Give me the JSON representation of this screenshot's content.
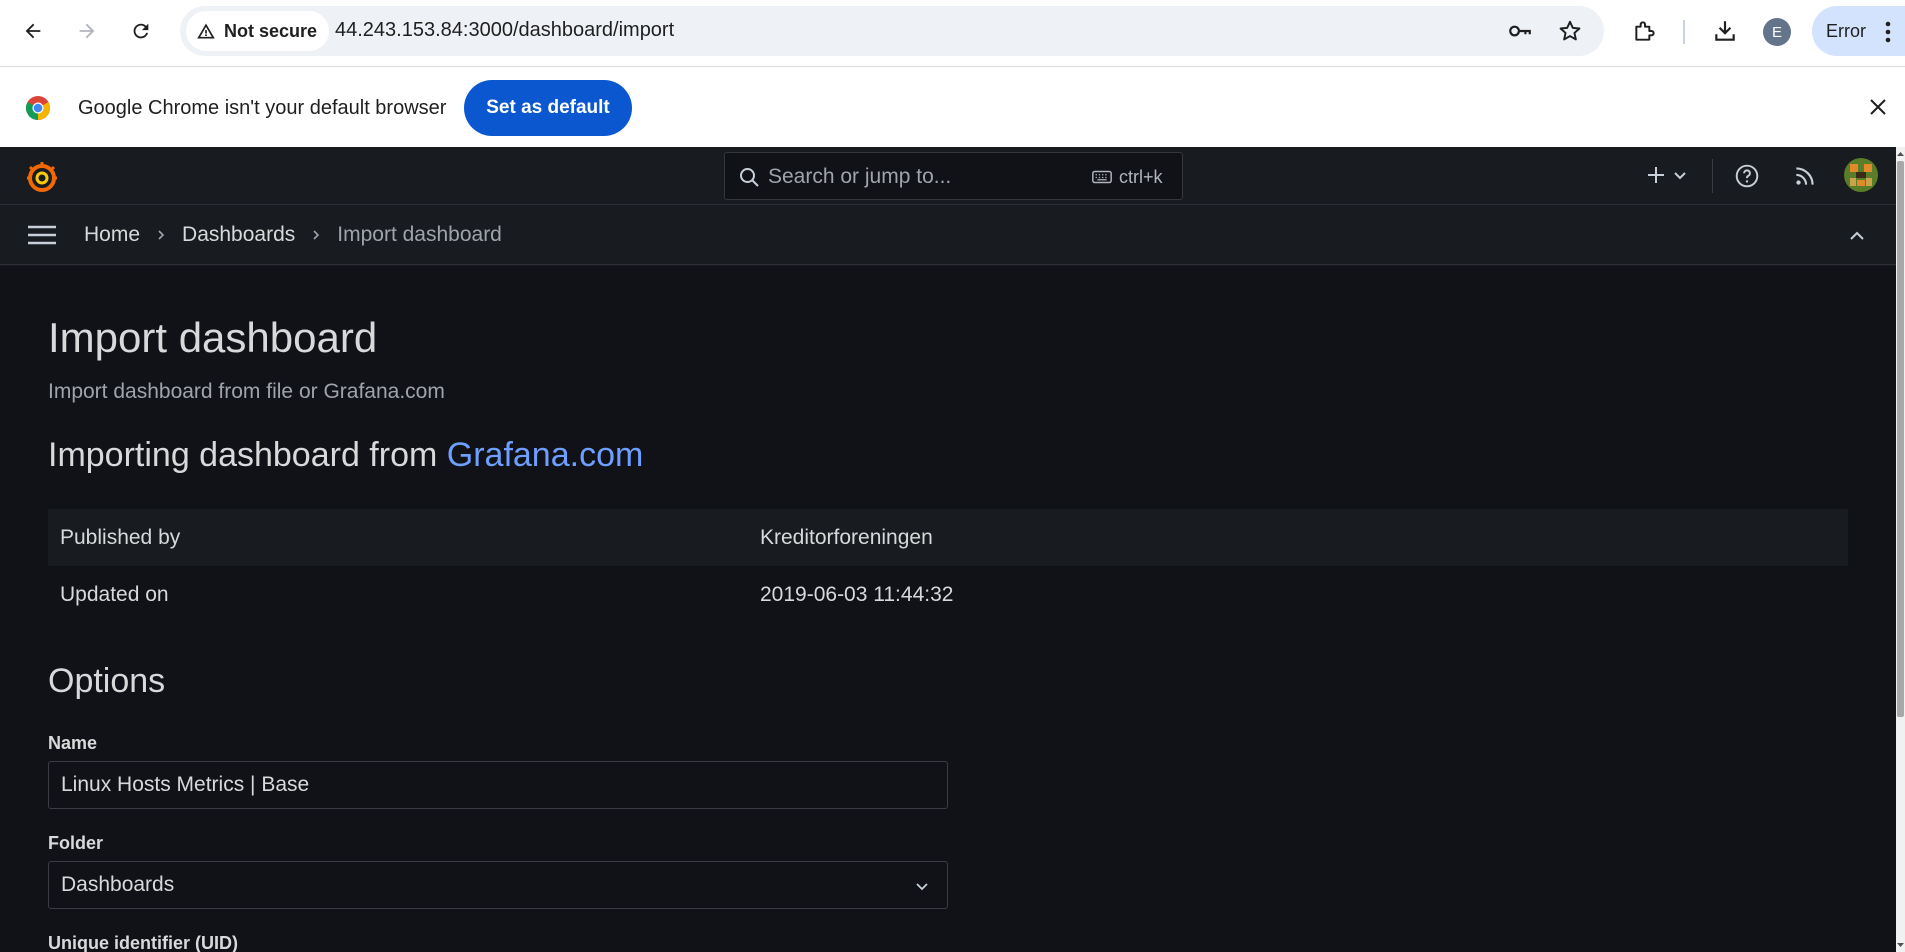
{
  "browser": {
    "security_label": "Not secure",
    "url": "44.243.153.84:3000/dashboard/import",
    "profile_initial": "E",
    "error_label": "Error"
  },
  "infobar": {
    "message": "Google Chrome isn't your default browser",
    "button_label": "Set as default"
  },
  "topnav": {
    "search_placeholder": "Search or jump to...",
    "shortcut": "ctrl+k"
  },
  "breadcrumb": [
    {
      "label": "Home"
    },
    {
      "label": "Dashboards"
    },
    {
      "label": "Import dashboard"
    }
  ],
  "page": {
    "title": "Import dashboard",
    "subtitle": "Import dashboard from file or Grafana.com",
    "import_heading_prefix": "Importing dashboard from ",
    "import_heading_link": "Grafana.com"
  },
  "info_rows": [
    {
      "key": "Published by",
      "value": "Kreditorforeningen"
    },
    {
      "key": "Updated on",
      "value": "2019-06-03 11:44:32"
    }
  ],
  "options": {
    "heading": "Options",
    "name_label": "Name",
    "name_value": "Linux Hosts Metrics | Base",
    "folder_label": "Folder",
    "folder_value": "Dashboards",
    "uid_label": "Unique identifier (UID)"
  },
  "colors": {
    "accent_link": "#6e9fff",
    "chrome_primary": "#0b57d0",
    "background": "#111217"
  }
}
